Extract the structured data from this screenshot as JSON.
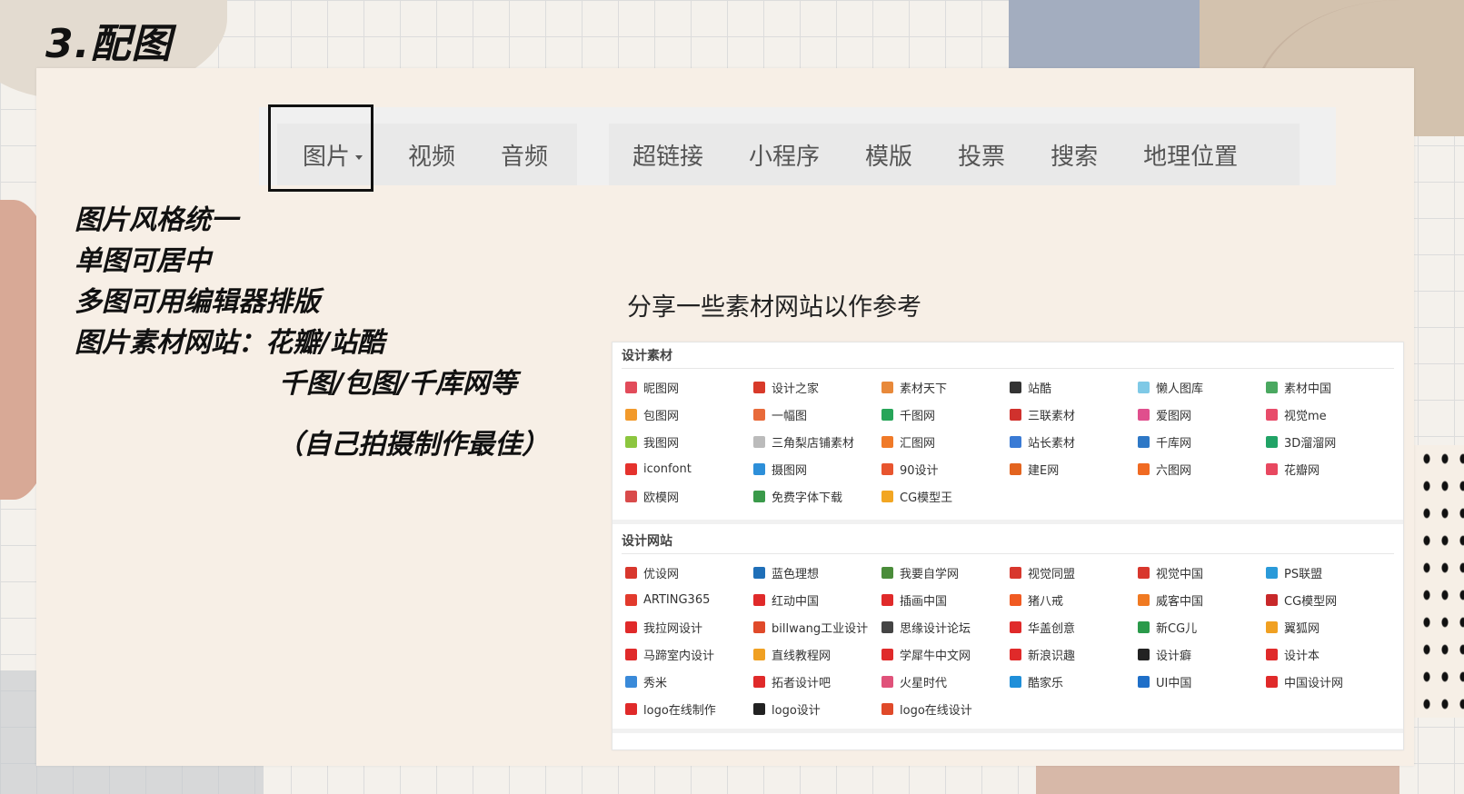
{
  "title": "3.配图",
  "tabs_group1": [
    {
      "label": "图片",
      "has_dropdown": true
    },
    {
      "label": "视频"
    },
    {
      "label": "音频"
    }
  ],
  "tabs_group2": [
    "超链接",
    "小程序",
    "模版",
    "投票",
    "搜索",
    "地理位置"
  ],
  "notes": [
    "图片风格统一",
    "单图可居中",
    "多图可用编辑器排版",
    "图片素材网站：花瓣/站酷",
    "千图/包图/千库网等",
    "（自己拍摄制作最佳）"
  ],
  "share_text": "分享一些素材网站以作参考",
  "sections": [
    {
      "heading": "设计素材",
      "items": [
        {
          "label": "昵图网",
          "color": "#e24b5a"
        },
        {
          "label": "设计之家",
          "color": "#d83a2a"
        },
        {
          "label": "素材天下",
          "color": "#e8893a"
        },
        {
          "label": "站酷",
          "color": "#333333"
        },
        {
          "label": "懒人图库",
          "color": "#7fc9e6"
        },
        {
          "label": "素材中国",
          "color": "#4aa860"
        },
        {
          "label": "包图网",
          "color": "#f29a2b"
        },
        {
          "label": "一幅图",
          "color": "#e86a3a"
        },
        {
          "label": "千图网",
          "color": "#27a559"
        },
        {
          "label": "三联素材",
          "color": "#d0312d"
        },
        {
          "label": "爱图网",
          "color": "#e04f8d"
        },
        {
          "label": "视觉me",
          "color": "#e84c6a"
        },
        {
          "label": "我图网",
          "color": "#8cc63f"
        },
        {
          "label": "三角梨店铺素材",
          "color": "#bbbbbb"
        },
        {
          "label": "汇图网",
          "color": "#f07a28"
        },
        {
          "label": "站长素材",
          "color": "#3a7bd5"
        },
        {
          "label": "千库网",
          "color": "#2e78c6"
        },
        {
          "label": "3D溜溜网",
          "color": "#21a366"
        },
        {
          "label": "iconfont",
          "color": "#e5322d"
        },
        {
          "label": "摄图网",
          "color": "#2d8fd9"
        },
        {
          "label": "90设计",
          "color": "#e8552f"
        },
        {
          "label": "建E网",
          "color": "#e3641f"
        },
        {
          "label": "六图网",
          "color": "#f06a22"
        },
        {
          "label": "花瓣网",
          "color": "#e84860"
        },
        {
          "label": "欧模网",
          "color": "#d94b4b"
        },
        {
          "label": "免费字体下载",
          "color": "#3a9a4a"
        },
        {
          "label": "CG模型王",
          "color": "#f2a623"
        }
      ]
    },
    {
      "heading": "设计网站",
      "items": [
        {
          "label": "优设网",
          "color": "#d8372d"
        },
        {
          "label": "蓝色理想",
          "color": "#1f6fb8"
        },
        {
          "label": "我要自学网",
          "color": "#4a8c3a"
        },
        {
          "label": "视觉同盟",
          "color": "#d8372d"
        },
        {
          "label": "视觉中国",
          "color": "#d8372d"
        },
        {
          "label": "PS联盟",
          "color": "#2a9ad9"
        },
        {
          "label": "ARTING365",
          "color": "#e23a2d"
        },
        {
          "label": "红动中国",
          "color": "#e02a2a"
        },
        {
          "label": "插画中国",
          "color": "#e02a2a"
        },
        {
          "label": "猪八戒",
          "color": "#f05a22"
        },
        {
          "label": "威客中国",
          "color": "#f07a22"
        },
        {
          "label": "CG模型网",
          "color": "#c8282a"
        },
        {
          "label": "我拉网设计",
          "color": "#e02a2a"
        },
        {
          "label": "billwang工业设计",
          "color": "#e04a2a"
        },
        {
          "label": "思缘设计论坛",
          "color": "#444444"
        },
        {
          "label": "华盖创意",
          "color": "#e02a2a"
        },
        {
          "label": "新CG儿",
          "color": "#2a9a4a"
        },
        {
          "label": "翼狐网",
          "color": "#f0a022"
        },
        {
          "label": "马蹄室内设计",
          "color": "#e02a2a"
        },
        {
          "label": "直线教程网",
          "color": "#f0a022"
        },
        {
          "label": "学犀牛中文网",
          "color": "#e02a2a"
        },
        {
          "label": "新浪识趣",
          "color": "#e02a2a"
        },
        {
          "label": "设计癖",
          "color": "#222222"
        },
        {
          "label": "设计本",
          "color": "#e02a2a"
        },
        {
          "label": "秀米",
          "color": "#3a8ad9"
        },
        {
          "label": "拓者设计吧",
          "color": "#e02a2a"
        },
        {
          "label": "火星时代",
          "color": "#e0527a"
        },
        {
          "label": "酷家乐",
          "color": "#1f8fd9"
        },
        {
          "label": "UI中国",
          "color": "#1f6fc8"
        },
        {
          "label": "中国设计网",
          "color": "#e02a2a"
        },
        {
          "label": "logo在线制作",
          "color": "#e02a2a"
        },
        {
          "label": "logo设计",
          "color": "#222222"
        },
        {
          "label": "logo在线设计",
          "color": "#e04a2a"
        }
      ]
    }
  ]
}
